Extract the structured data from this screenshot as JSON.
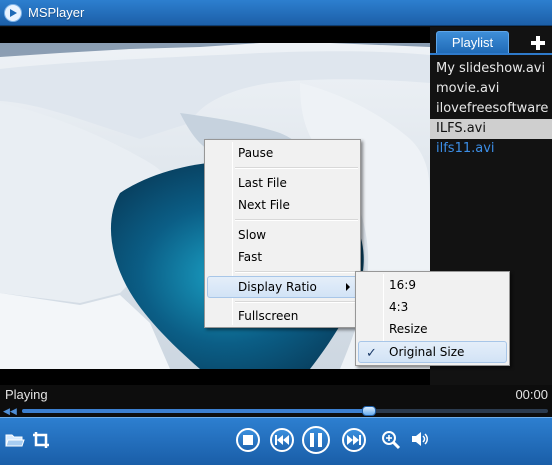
{
  "window": {
    "title": "MSPlayer",
    "app_icon": "play-circle-icon"
  },
  "playlist": {
    "tab_label": "Playlist",
    "add_icon": "plus-icon",
    "items": [
      {
        "label": "My slideshow.avi",
        "state": "normal"
      },
      {
        "label": "movie.avi",
        "state": "normal"
      },
      {
        "label": "ilovefreesoftware",
        "state": "normal"
      },
      {
        "label": "ILFS.avi",
        "state": "selected"
      },
      {
        "label": "ilfs11.avi",
        "state": "playing"
      }
    ]
  },
  "status": {
    "state_text": "Playing",
    "time_text": "00:00"
  },
  "seek": {
    "progress_fraction": 0.66
  },
  "context_menu": {
    "pause": "Pause",
    "last_file": "Last File",
    "next_file": "Next File",
    "slow": "Slow",
    "fast": "Fast",
    "display_ratio": "Display Ratio",
    "fullscreen": "Fullscreen"
  },
  "display_ratio_menu": {
    "options": [
      "16:9",
      "4:3",
      "Resize",
      "Original Size"
    ],
    "checked": "Original Size",
    "check_symbol": "✓"
  },
  "controls": {
    "icons": [
      "open-folder-icon",
      "crop-icon",
      "stop-icon",
      "previous-icon",
      "pause-icon",
      "next-icon",
      "zoom-in-icon",
      "volume-icon"
    ]
  },
  "colors": {
    "accent": "#1f6ab6",
    "playing_item": "#3c8ee6",
    "selected_row": "#cfcfcf"
  }
}
